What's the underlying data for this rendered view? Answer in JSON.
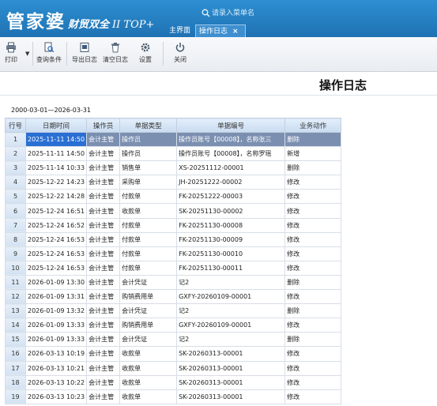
{
  "app": {
    "brand_cn": "管家婆",
    "brand_sub": "财贸双全",
    "brand_version": "II TOP+",
    "search_placeholder": "请录入菜单名"
  },
  "tabs": [
    {
      "label": "主界面"
    },
    {
      "label": "操作日志",
      "close": "×"
    }
  ],
  "toolbar": {
    "print": "打印",
    "query": "查询条件",
    "export": "导出日志",
    "clear": "清空日志",
    "settings": "设置",
    "close": "关闭"
  },
  "report": {
    "title": "操作日志",
    "date_range": "2000-03-01—2026-03-31"
  },
  "columns": [
    "行号",
    "日期时间",
    "操作员",
    "单据类型",
    "单据编号",
    "业务动作"
  ],
  "rows": [
    [
      "1",
      "2025-11-11 14:50",
      "会计主管",
      "操作员",
      "操作员账号【00008】，名称张三",
      "删除"
    ],
    [
      "2",
      "2025-11-11 14:50",
      "会计主管",
      "操作员",
      "操作员账号【00008】，名称罗瑶",
      "新增"
    ],
    [
      "3",
      "2025-11-14 10:33",
      "会计主管",
      "销售单",
      "XS-20251112-00001",
      "删除"
    ],
    [
      "4",
      "2025-12-22 14:23",
      "会计主管",
      "采购单",
      "JH-20251222-00002",
      "修改"
    ],
    [
      "5",
      "2025-12-22 14:28",
      "会计主管",
      "付款单",
      "FK-20251222-00003",
      "修改"
    ],
    [
      "6",
      "2025-12-24 16:51",
      "会计主管",
      "收款单",
      "SK-20251130-00002",
      "修改"
    ],
    [
      "7",
      "2025-12-24 16:52",
      "会计主管",
      "付款单",
      "FK-20251130-00008",
      "修改"
    ],
    [
      "8",
      "2025-12-24 16:53",
      "会计主管",
      "付款单",
      "FK-20251130-00009",
      "修改"
    ],
    [
      "9",
      "2025-12-24 16:53",
      "会计主管",
      "付款单",
      "FK-20251130-00010",
      "修改"
    ],
    [
      "10",
      "2025-12-24 16:53",
      "会计主管",
      "付款单",
      "FK-20251130-00011",
      "修改"
    ],
    [
      "11",
      "2026-01-09 13:30",
      "会计主管",
      "会计凭证",
      "记2",
      "删除"
    ],
    [
      "12",
      "2026-01-09 13:31",
      "会计主管",
      "购销费用单",
      "GXFY-20260109-00001",
      "修改"
    ],
    [
      "13",
      "2026-01-09 13:32",
      "会计主管",
      "会计凭证",
      "记2",
      "删除"
    ],
    [
      "14",
      "2026-01-09 13:33",
      "会计主管",
      "购销费用单",
      "GXFY-20260109-00001",
      "修改"
    ],
    [
      "15",
      "2026-01-09 13:33",
      "会计主管",
      "会计凭证",
      "记2",
      "删除"
    ],
    [
      "16",
      "2026-03-13 10:19",
      "会计主管",
      "收款单",
      "SK-20260313-00001",
      "修改"
    ],
    [
      "17",
      "2026-03-13 10:21",
      "会计主管",
      "收款单",
      "SK-20260313-00001",
      "修改"
    ],
    [
      "18",
      "2026-03-13 10:22",
      "会计主管",
      "收款单",
      "SK-20260313-00001",
      "修改"
    ],
    [
      "19",
      "2026-03-13 10:23",
      "会计主管",
      "收款单",
      "SK-20260313-00001",
      "修改"
    ]
  ],
  "selected_row": 1,
  "colors": {
    "header_blue": "#2d8fd1",
    "selected_row": "#7b8fb1",
    "selected_cell": "#2a6fd3",
    "grid_header": "#c9dcf1"
  }
}
